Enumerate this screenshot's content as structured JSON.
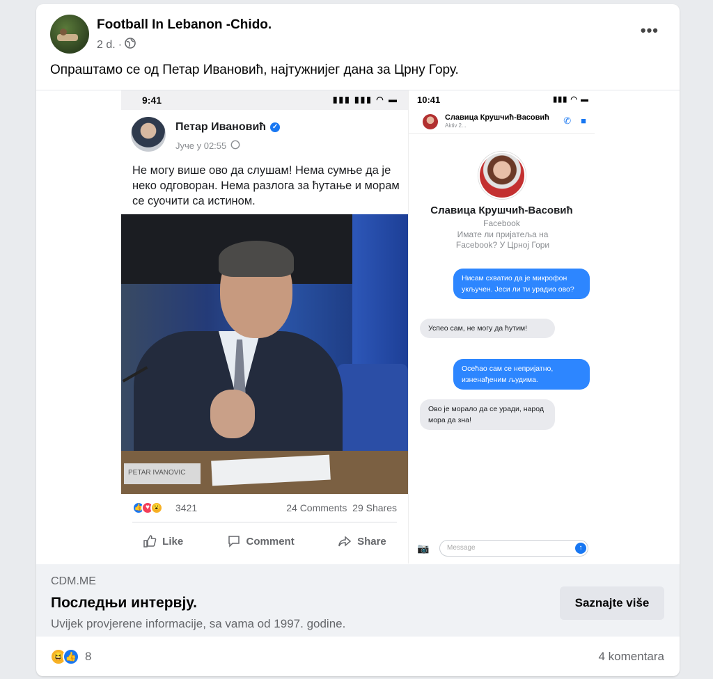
{
  "post": {
    "page_name": "Football In Lebanon -Chido.",
    "time": "2 d.",
    "dot": "·",
    "more": "•••",
    "caption": "Опраштамо се од Петар Ивановић, најтужнијег дана за Црну Гору."
  },
  "image_left": {
    "status_time": "9:41",
    "author": "Петар Ивановић",
    "date": "Јуче у 02:55",
    "text": "Не могу више ово да слушам! Нема сумње да је неко одговоран. Нема разлога за ћутање и морам се суочити са истином.",
    "nameplate": "PETAR IVANOVIC",
    "reaction_count": "3421",
    "comments": "24 Comments",
    "shares": "29 Shares",
    "actions": {
      "like": "Like",
      "comment": "Comment",
      "share": "Share"
    }
  },
  "image_right": {
    "status_time": "10:41",
    "contact_name": "Славица Крушчић-Васовић",
    "contact_status": "Aktiv 2...",
    "profile_name": "Славица Крушчић-Васовић",
    "profile_sub": "Facebook",
    "profile_question": "Имате ли пријатеља на Facebook? У Црној Гори",
    "messages": [
      {
        "dir": "out",
        "text": "Нисам схватио да је микрофон укључен. Јеси ли ти урадио ово?"
      },
      {
        "dir": "in",
        "text": "Успео сам, не могу да ћутим!"
      },
      {
        "dir": "out",
        "text": "Осећао сам се непријатно, изненађеним људима."
      },
      {
        "dir": "in",
        "text": "Ово је морало да се уради, народ мора да зна!"
      }
    ],
    "message_placeholder": "Message"
  },
  "link": {
    "domain": "CDM.ME",
    "title": "Последњи интервју.",
    "description": "Uvijek provjerene informacije, sa vama od 1997. godine.",
    "button": "Saznajte više"
  },
  "footer": {
    "reaction_count": "8",
    "comments": "4 komentara"
  },
  "colors": {
    "accent": "#1877f2",
    "bubble_out": "#2d86ff",
    "bubble_in": "#e9eaee",
    "link_bg": "#f0f2f5"
  }
}
